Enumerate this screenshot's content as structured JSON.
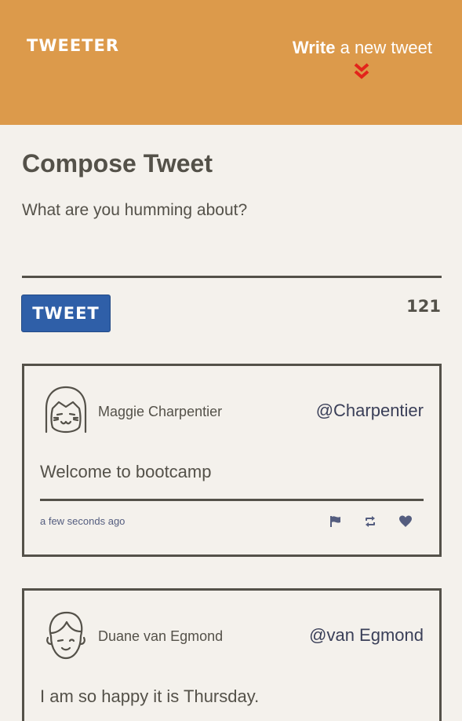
{
  "header": {
    "logo": "TWEETER",
    "write_strong": "Write",
    "write_rest": " a new tweet",
    "chevron_icon": "double-chevron-down-icon"
  },
  "compose": {
    "title": "Compose Tweet",
    "placeholder": "What are you humming about?",
    "button_label": "TWEET",
    "counter": "121"
  },
  "tweets": [
    {
      "avatar_icon": "girl-avatar-icon",
      "name": "Maggie Charpentier",
      "handle": "@Charpentier",
      "content": "Welcome to bootcamp",
      "timestamp": "a few seconds ago",
      "actions": [
        "flag-icon",
        "retweet-icon",
        "heart-icon"
      ]
    },
    {
      "avatar_icon": "boy-avatar-icon",
      "name": "Duane van Egmond",
      "handle": "@van Egmond",
      "content": "I am so happy it is Thursday."
    }
  ],
  "colors": {
    "header_bg": "#dc9a4b",
    "page_bg": "#f4f1ec",
    "text": "#545149",
    "button_bg": "#2f5fa8",
    "chevron": "#e3241b",
    "action_icons": "#545d7f"
  }
}
